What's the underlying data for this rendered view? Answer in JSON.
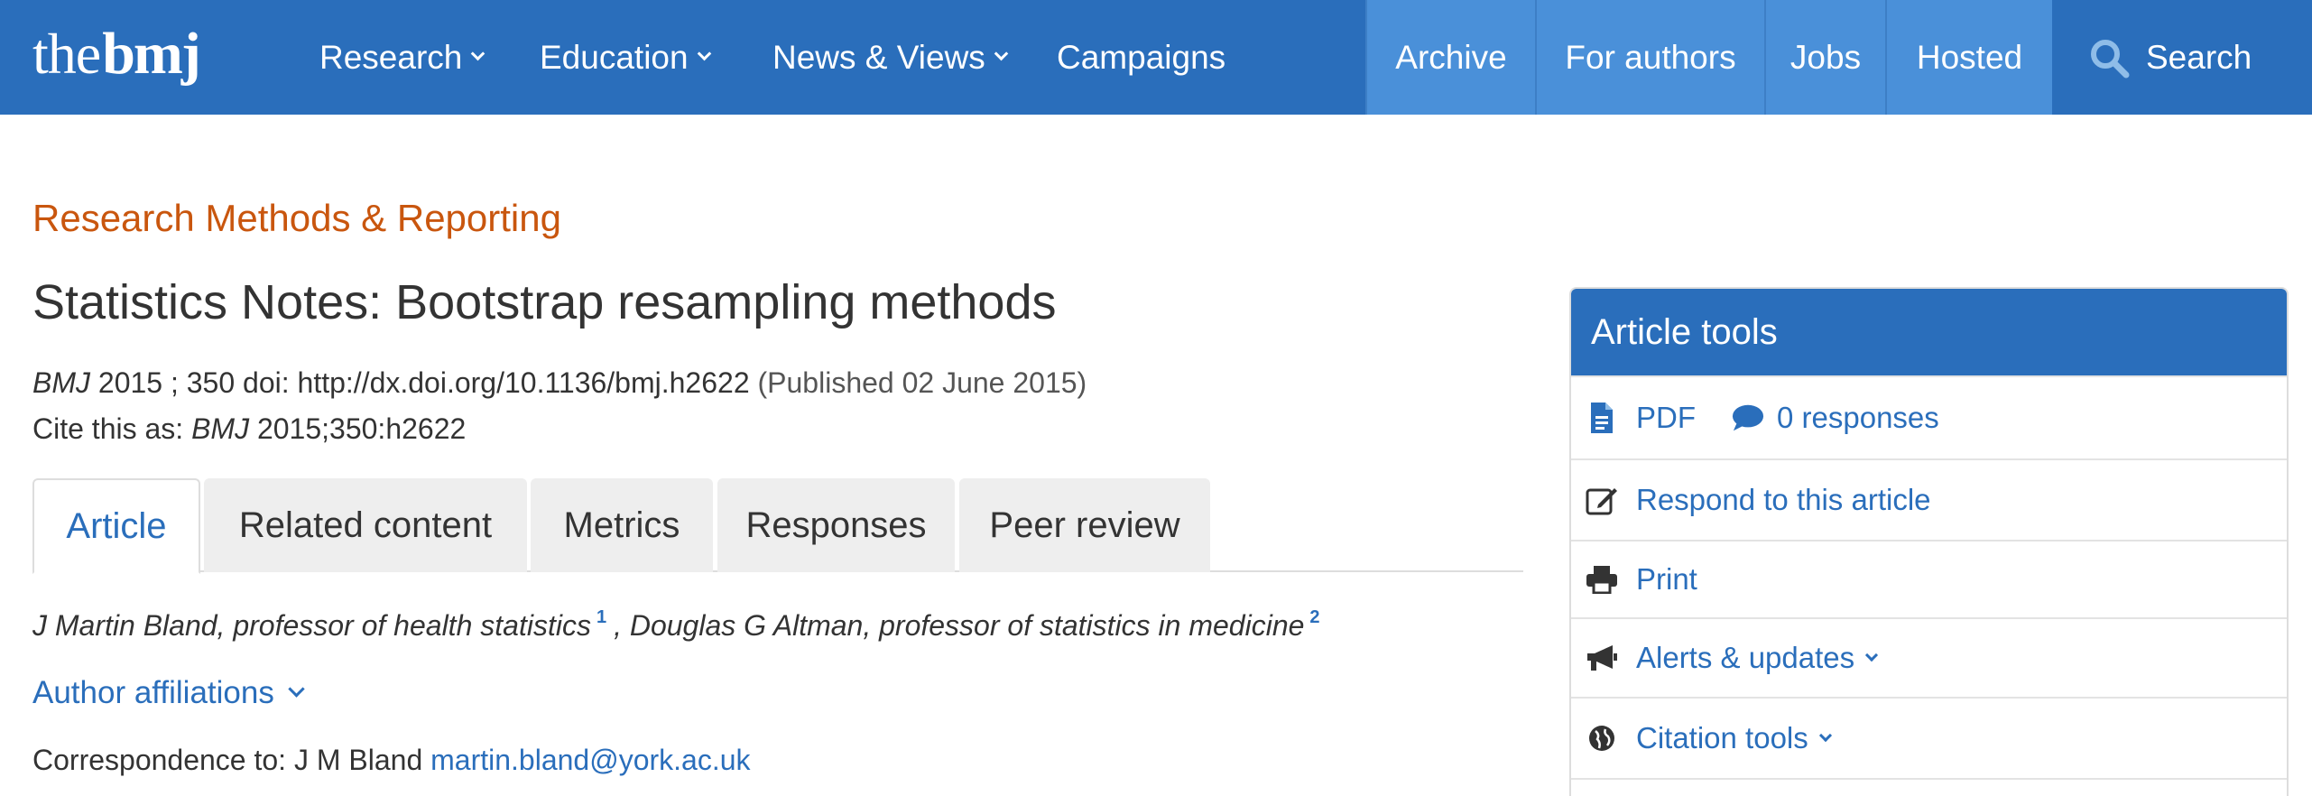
{
  "brand": {
    "logo_the": "the",
    "logo_bmj": "bmj"
  },
  "nav": {
    "left": [
      "Research",
      "Education",
      "News & Views",
      "Campaigns"
    ],
    "right": [
      "Archive",
      "For authors",
      "Jobs",
      "Hosted"
    ],
    "search_label": "Search"
  },
  "article": {
    "section": "Research Methods & Reporting",
    "title": "Statistics Notes: Bootstrap resampling methods",
    "journal": "BMJ",
    "year_volume": " 2015 ; 350 ",
    "doi": " doi: http://dx.doi.org/10.1136/bmj.h2622",
    "published": " (Published 02 June 2015)",
    "cite_prefix": "Cite this as: ",
    "cite_journal": "BMJ",
    "cite_ref": " 2015;350:h2622"
  },
  "tabs": [
    "Article",
    "Related content",
    "Metrics",
    "Responses",
    "Peer review"
  ],
  "authors": {
    "author1": "J Martin Bland, professor of health statistics",
    "sup1": "1",
    "author2": ", Douglas G Altman, professor of statistics in medicine",
    "sup2": "2",
    "affiliations_label": "Author affiliations",
    "correspondence_prefix": "Correspondence to: J M Bland ",
    "correspondence_email": "martin.bland@york.ac.uk"
  },
  "tools": {
    "heading": "Article tools",
    "pdf": "PDF",
    "responses": "0 responses",
    "respond": "Respond to this article",
    "print": "Print",
    "alerts": "Alerts & updates",
    "citation": "Citation tools"
  },
  "colors": {
    "brand_blue": "#2a6ebb",
    "section_orange": "#c9560e",
    "nav_highlight": "#4a90d9"
  },
  "icons": [
    "search-icon",
    "pdf-icon",
    "comment-icon",
    "edit-icon",
    "print-icon",
    "megaphone-icon",
    "globe-icon"
  ]
}
